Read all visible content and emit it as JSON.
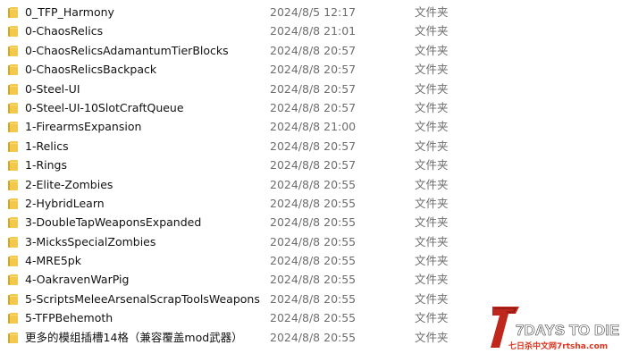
{
  "file_list": {
    "items": [
      {
        "name": "0_TFP_Harmony",
        "date": "2024/8/5 12:17",
        "type": "文件夹"
      },
      {
        "name": "0-ChaosRelics",
        "date": "2024/8/8 21:01",
        "type": "文件夹"
      },
      {
        "name": "0-ChaosRelicsAdamantumTierBlocks",
        "date": "2024/8/8 20:57",
        "type": "文件夹"
      },
      {
        "name": "0-ChaosRelicsBackpack",
        "date": "2024/8/8 20:57",
        "type": "文件夹"
      },
      {
        "name": "0-Steel-UI",
        "date": "2024/8/8 20:57",
        "type": "文件夹"
      },
      {
        "name": "0-Steel-UI-10SlotCraftQueue",
        "date": "2024/8/8 20:57",
        "type": "文件夹"
      },
      {
        "name": "1-FirearmsExpansion",
        "date": "2024/8/8 21:00",
        "type": "文件夹"
      },
      {
        "name": "1-Relics",
        "date": "2024/8/8 20:57",
        "type": "文件夹"
      },
      {
        "name": "1-Rings",
        "date": "2024/8/8 20:57",
        "type": "文件夹"
      },
      {
        "name": "2-Elite-Zombies",
        "date": "2024/8/8 20:55",
        "type": "文件夹"
      },
      {
        "name": "2-HybridLearn",
        "date": "2024/8/8 20:55",
        "type": "文件夹"
      },
      {
        "name": "3-DoubleTapWeaponsExpanded",
        "date": "2024/8/8 20:55",
        "type": "文件夹"
      },
      {
        "name": "3-MicksSpecialZombies",
        "date": "2024/8/8 20:55",
        "type": "文件夹"
      },
      {
        "name": "4-MRE5pk",
        "date": "2024/8/8 20:55",
        "type": "文件夹"
      },
      {
        "name": "4-OakravenWarPig",
        "date": "2024/8/8 20:55",
        "type": "文件夹"
      },
      {
        "name": "5-ScriptsMeleeArsenalScrapToolsWeapons",
        "date": "2024/8/8 20:55",
        "type": "文件夹"
      },
      {
        "name": "5-TFPBehemoth",
        "date": "2024/8/8 20:55",
        "type": "文件夹"
      },
      {
        "name": "更多的模组插槽14格（兼容覆盖mod武器）",
        "date": "2024/8/8 20:55",
        "type": "文件夹"
      }
    ]
  },
  "watermark": {
    "title": "7DAYS TO DIE",
    "subtitle": "七日杀中文网7rtsha.com",
    "icon": "7-days-to-die-logo"
  },
  "colors": {
    "folder_yellow": "#f2c94c",
    "folder_dark": "#d9a520",
    "date_gray": "#6d6d6d",
    "logo_red": "#c0271c"
  }
}
